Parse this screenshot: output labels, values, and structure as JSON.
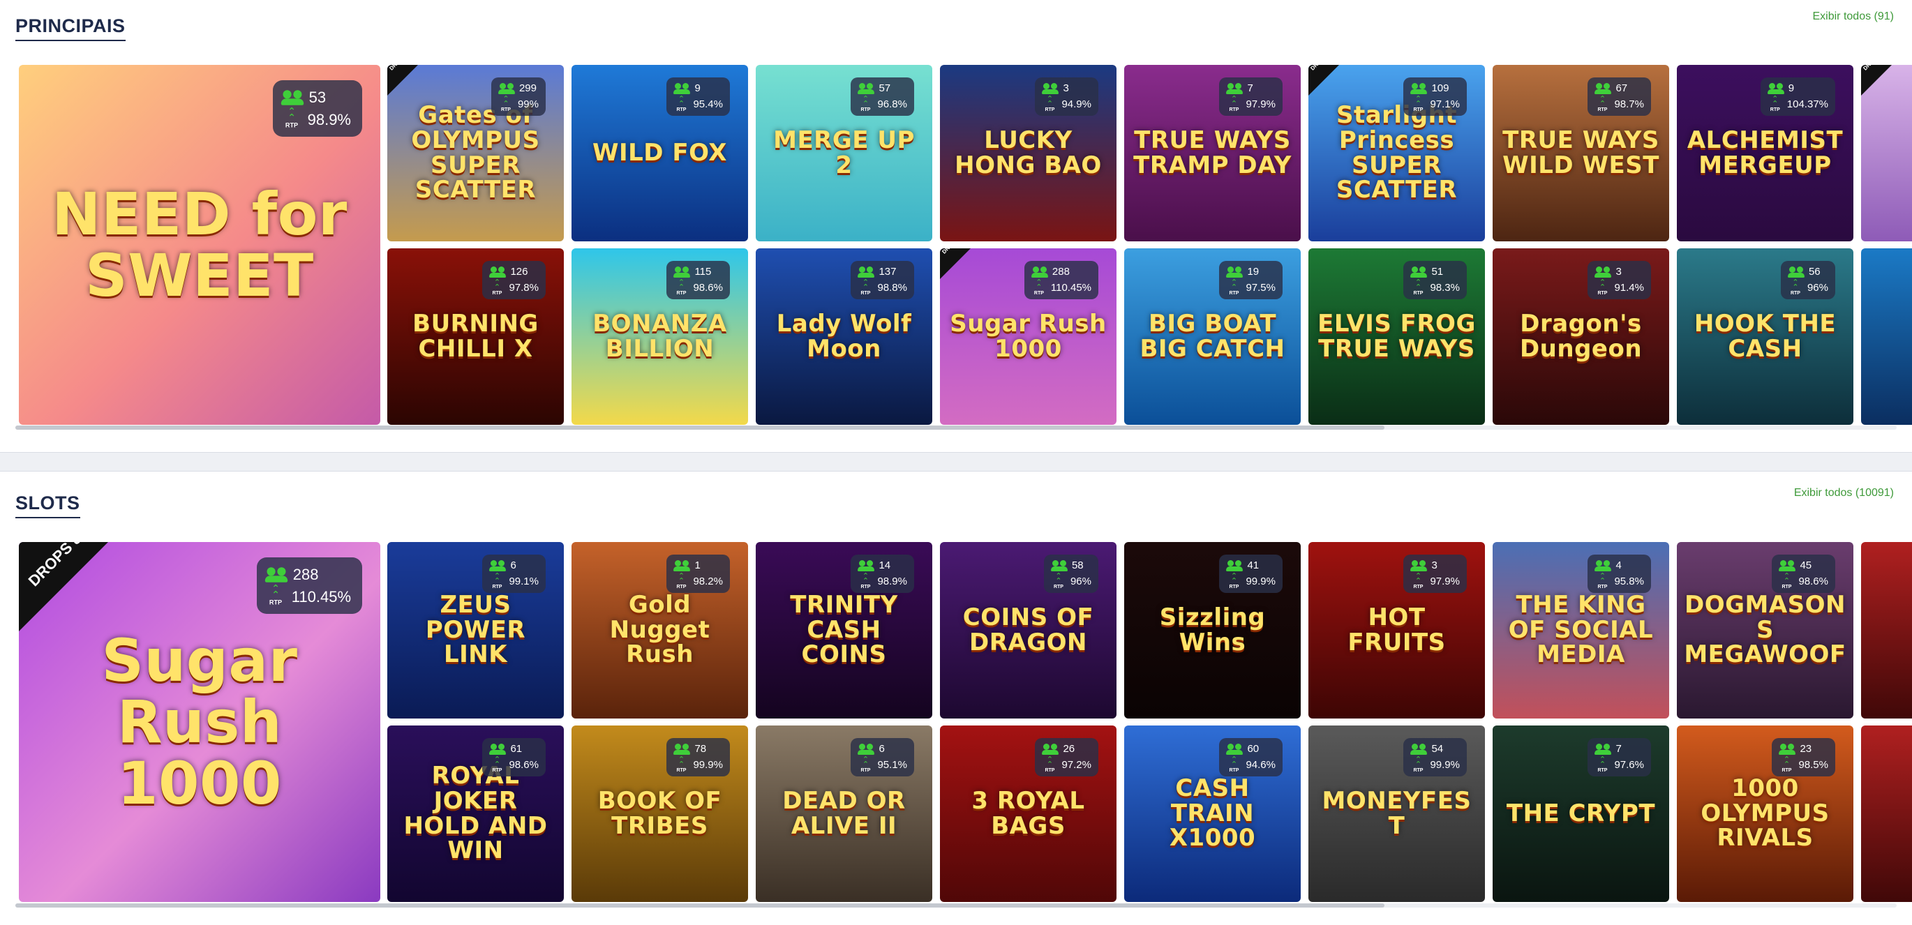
{
  "sections": [
    {
      "title": "PRINCIPAIS",
      "view_all": "Exibir todos (91)",
      "featured": {
        "art": "NEED for SWEET",
        "players": "53",
        "rtp": "98.9%",
        "drops": false,
        "bg": "linear-gradient(135deg,#ffcf7d,#f58a8a 55%,#c45aa8)"
      },
      "row1": [
        {
          "art": "Gates of OLYMPUS SUPER SCATTER",
          "players": "299",
          "rtp": "99%",
          "drops": true,
          "bg": "linear-gradient(180deg,#5a7ad6,#c59b4d)"
        },
        {
          "art": "WILD FOX",
          "players": "9",
          "rtp": "95.4%",
          "drops": false,
          "bg": "linear-gradient(180deg,#1f7ad8,#0b2f80)"
        },
        {
          "art": "MERGE UP 2",
          "players": "57",
          "rtp": "96.8%",
          "drops": false,
          "bg": "linear-gradient(180deg,#77e0d1,#3bb1c7)"
        },
        {
          "art": "LUCKY HONG BAO",
          "players": "3",
          "rtp": "94.9%",
          "drops": false,
          "bg": "linear-gradient(180deg,#1b3a82,#7a1413)"
        },
        {
          "art": "TRUE WAYS TRAMP DAY",
          "players": "7",
          "rtp": "97.9%",
          "drops": false,
          "bg": "linear-gradient(180deg,#8a2c8d,#4a0f4a)"
        },
        {
          "art": "Starlight Princess SUPER SCATTER",
          "players": "109",
          "rtp": "97.1%",
          "drops": true,
          "bg": "linear-gradient(180deg,#4aa3ee,#1a3e9b)"
        },
        {
          "art": "TRUE WAYS WILD WEST",
          "players": "67",
          "rtp": "98.7%",
          "drops": false,
          "bg": "linear-gradient(180deg,#b7703e,#4d2512)"
        },
        {
          "art": "ALCHEMIST MERGEUP",
          "players": "9",
          "rtp": "104.37%",
          "drops": false,
          "bg": "linear-gradient(180deg,#3c0f5e,#2a0a3f)"
        },
        {
          "art": "",
          "players": "",
          "rtp": "",
          "drops": true,
          "bg": "linear-gradient(180deg,#d8b3e8,#8e5bb7)"
        }
      ],
      "row2": [
        {
          "art": "BURNING CHILLI X",
          "players": "126",
          "rtp": "97.8%",
          "drops": false,
          "bg": "linear-gradient(180deg,#8a1108,#2b0502)"
        },
        {
          "art": "BONANZA BILLION",
          "players": "115",
          "rtp": "98.6%",
          "drops": false,
          "bg": "linear-gradient(180deg,#2ec6ea,#f3d94a)"
        },
        {
          "art": "Lady Wolf Moon",
          "players": "137",
          "rtp": "98.8%",
          "drops": false,
          "bg": "linear-gradient(180deg,#1f4fb1,#0a1840)"
        },
        {
          "art": "Sugar Rush 1000",
          "players": "288",
          "rtp": "110.45%",
          "drops": true,
          "bg": "linear-gradient(180deg,#a64ad6,#d36cc2)"
        },
        {
          "art": "BIG BOAT BIG CATCH",
          "players": "19",
          "rtp": "97.5%",
          "drops": false,
          "bg": "linear-gradient(180deg,#3c9fe0,#0b4f98)"
        },
        {
          "art": "ELVIS FROG TRUE WAYS",
          "players": "51",
          "rtp": "98.3%",
          "drops": false,
          "bg": "linear-gradient(180deg,#1d7a35,#0a2d16)"
        },
        {
          "art": "Dragon's Dungeon",
          "players": "3",
          "rtp": "91.4%",
          "drops": false,
          "bg": "linear-gradient(180deg,#7a1a1a,#2a0808)"
        },
        {
          "art": "HOOK THE CASH",
          "players": "56",
          "rtp": "96%",
          "drops": false,
          "bg": "linear-gradient(180deg,#2b7a8a,#0d2e3a)"
        },
        {
          "art": "",
          "players": "",
          "rtp": "",
          "drops": false,
          "bg": "linear-gradient(180deg,#1b7ac6,#0b2e60)"
        }
      ]
    },
    {
      "title": "SLOTS",
      "view_all": "Exibir todos (10091)",
      "featured": {
        "art": "Sugar Rush 1000",
        "players": "288",
        "rtp": "110.45%",
        "drops": true,
        "bg": "linear-gradient(135deg,#b04be0,#e58bd7 55%,#8a3ac0)"
      },
      "row1": [
        {
          "art": "ZEUS POWER LINK",
          "players": "6",
          "rtp": "99.1%",
          "drops": false,
          "bg": "linear-gradient(180deg,#1a3c9a,#0a1b55)"
        },
        {
          "art": "Gold Nugget Rush",
          "players": "1",
          "rtp": "98.2%",
          "drops": false,
          "bg": "linear-gradient(180deg,#c5622a,#5a230b)"
        },
        {
          "art": "TRINITY CASH COINS",
          "players": "14",
          "rtp": "98.9%",
          "drops": false,
          "bg": "linear-gradient(180deg,#3a0b57,#14041f)"
        },
        {
          "art": "COINS OF DRAGON",
          "players": "58",
          "rtp": "96%",
          "drops": false,
          "bg": "linear-gradient(180deg,#4b1a73,#1d0830)"
        },
        {
          "art": "Sizzling Wins",
          "players": "41",
          "rtp": "99.9%",
          "drops": false,
          "bg": "linear-gradient(180deg,#1c0a0a,#0a0303)"
        },
        {
          "art": "HOT FRUITS",
          "players": "3",
          "rtp": "97.9%",
          "drops": false,
          "bg": "linear-gradient(180deg,#a0120f,#3d0504)"
        },
        {
          "art": "THE KING OF SOCIAL MEDIA",
          "players": "4",
          "rtp": "95.8%",
          "drops": false,
          "bg": "linear-gradient(180deg,#4b6fb5,#c2505a)"
        },
        {
          "art": "DOGMASONS MEGAWOOF",
          "players": "45",
          "rtp": "98.6%",
          "drops": false,
          "bg": "linear-gradient(180deg,#6a3d6e,#2a1830)"
        },
        {
          "art": "",
          "players": "",
          "rtp": "",
          "drops": false,
          "bg": "linear-gradient(180deg,#b02020,#400808)"
        }
      ],
      "row2": [
        {
          "art": "ROYAL JOKER HOLD AND WIN",
          "players": "61",
          "rtp": "98.6%",
          "drops": false,
          "bg": "linear-gradient(180deg,#2a0f5a,#120630)"
        },
        {
          "art": "BOOK OF TRIBES",
          "players": "78",
          "rtp": "99.9%",
          "drops": false,
          "bg": "linear-gradient(180deg,#c38b1c,#5a3a08)"
        },
        {
          "art": "DEAD OR ALIVE II",
          "players": "6",
          "rtp": "95.1%",
          "drops": false,
          "bg": "linear-gradient(180deg,#8a7a66,#3a2f25)"
        },
        {
          "art": "3 ROYAL BAGS",
          "players": "26",
          "rtp": "97.2%",
          "drops": false,
          "bg": "linear-gradient(180deg,#a41212,#500707)"
        },
        {
          "art": "CASH TRAIN X1000",
          "players": "60",
          "rtp": "94.6%",
          "drops": false,
          "bg": "linear-gradient(180deg,#2f6ed6,#0c2a7a)"
        },
        {
          "art": "MONEYFEST",
          "players": "54",
          "rtp": "99.9%",
          "drops": false,
          "bg": "linear-gradient(180deg,#5a5a5a,#2a2a2a)"
        },
        {
          "art": "THE CRYPT",
          "players": "7",
          "rtp": "97.6%",
          "drops": false,
          "bg": "linear-gradient(180deg,#1d3b2c,#0a1510)"
        },
        {
          "art": "1000 OLYMPUS RIVALS",
          "players": "23",
          "rtp": "98.5%",
          "drops": false,
          "bg": "linear-gradient(180deg,#d35b1d,#5a1a06)"
        },
        {
          "art": "",
          "players": "",
          "rtp": "",
          "drops": false,
          "bg": "linear-gradient(180deg,#b02020,#400808)"
        }
      ]
    }
  ],
  "labels": {
    "rtp_short": "RTP",
    "drops_wins": "DROPS & WINS"
  }
}
